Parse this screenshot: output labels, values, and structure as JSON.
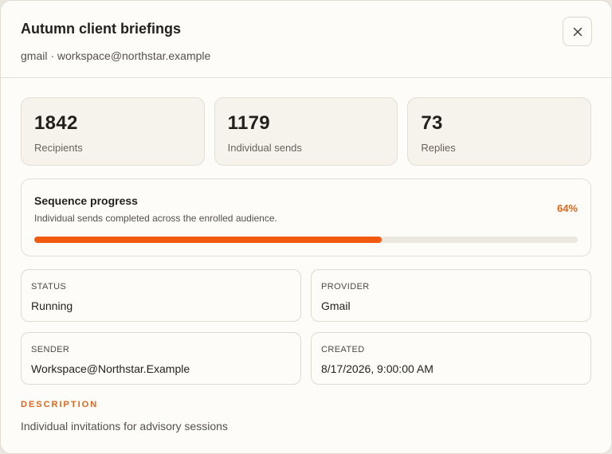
{
  "modal": {
    "title": "Autumn client briefings",
    "subtitle": "gmail · workspace@northstar.example",
    "close_icon": "close-icon"
  },
  "stats": [
    {
      "value": "1842",
      "label": "Recipients"
    },
    {
      "value": "1179",
      "label": "Individual sends"
    },
    {
      "value": "73",
      "label": "Replies"
    }
  ],
  "progress": {
    "title": "Sequence progress",
    "description": "Individual sends completed across the enrolled audience.",
    "percent_label": "64%",
    "percent_value": 64,
    "fill_color": "#f15a0f"
  },
  "details": {
    "status": {
      "label": "STATUS",
      "value": "Running"
    },
    "provider": {
      "label": "PROVIDER",
      "value": "Gmail"
    },
    "sender": {
      "label": "SENDER",
      "value": "Workspace@Northstar.Example"
    },
    "created": {
      "label": "CREATED",
      "value": "8/17/2026, 9:00:00 AM"
    }
  },
  "description": {
    "label": "DESCRIPTION",
    "text": "Individual invitations for advisory sessions"
  },
  "colors": {
    "accent": "#e0661b",
    "background": "#fdfcf9"
  }
}
